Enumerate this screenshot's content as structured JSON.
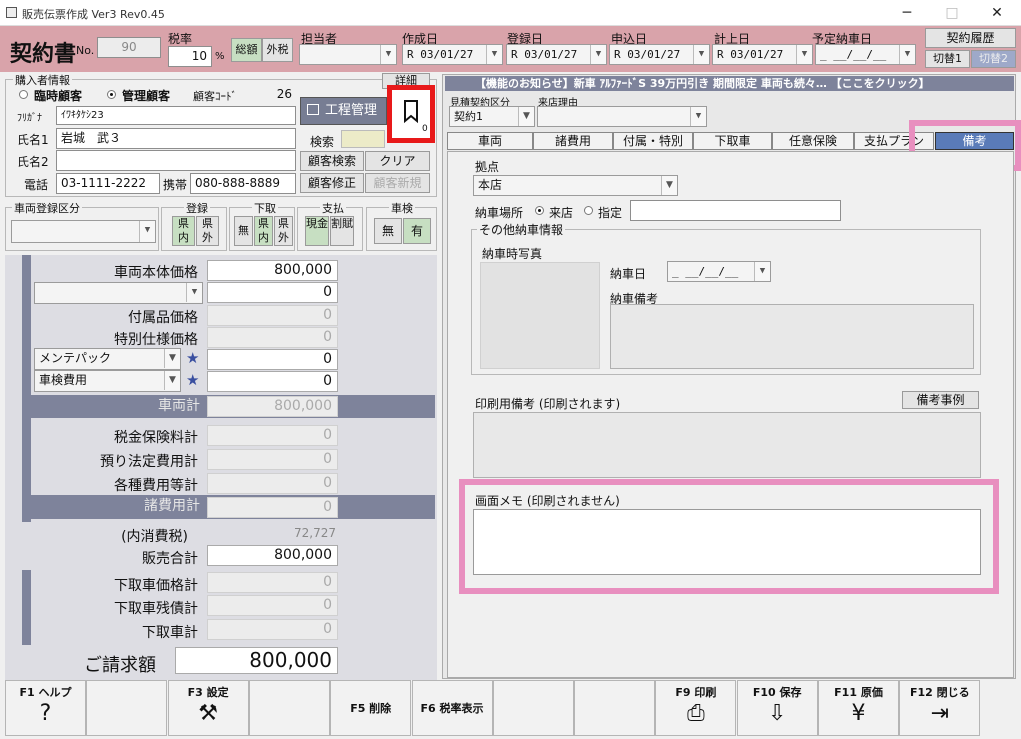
{
  "app": {
    "title": "販売伝票作成 Ver3 Rev0.45",
    "window_controls": [
      "─",
      "□",
      "✕"
    ]
  },
  "header": {
    "doc_title": "契約書",
    "no_label": "No.",
    "no_value": "90",
    "tax_label": "税率",
    "tax_value": "10",
    "tax_unit": "%",
    "tax_btn_total": "総額",
    "tax_btn_ex": "外税",
    "tanto_label": "担当者",
    "tanto_value": "",
    "created_label": "作成日",
    "created_value": "R 03/01/27",
    "reg_label": "登録日",
    "reg_value": "R 03/01/27",
    "apply_label": "申込日",
    "apply_value": "R 03/01/27",
    "post_label": "計上日",
    "post_value": "R 03/01/27",
    "due_label": "予定納車日",
    "due_value": "_ __/__/__",
    "history_btn": "契約履歴",
    "switch1": "切替1",
    "switch2": "切替2"
  },
  "buyer": {
    "group_label": "購入者情報",
    "detail_btn": "詳細",
    "radio_temp": "臨時顧客",
    "radio_mgmt": "管理顧客",
    "cust_code_label": "顧客ｺｰﾄﾞ",
    "cust_code": "26",
    "furigana_label": "ﾌﾘｶﾞﾅ",
    "furigana": "ｲﾜｷﾀｹｼ23",
    "name1_label": "氏名1",
    "name1": "岩城　武３",
    "name2_label": "氏名2",
    "name2": "",
    "phone_label": "電話",
    "phone": "03-1111-2222",
    "mobile_label": "携帯",
    "mobile": "080-888-8889",
    "koutei_btn": "工程管理",
    "search_label": "検索",
    "search_btn": "顧客検索",
    "clear_btn": "クリア",
    "modify_btn": "顧客修正",
    "new_btn": "顧客新規",
    "bookmark_count": "0"
  },
  "vehicle_reg": {
    "label": "車両登録区分",
    "reg_label": "登録",
    "reg_in": "県内",
    "reg_out": "県外",
    "trade_label": "下取",
    "trade_none": "無",
    "trade_in": "県内",
    "trade_out": "県外",
    "pay_label": "支払",
    "pay_cash": "現金",
    "pay_loan": "割賦",
    "inspect_label": "車検",
    "inspect_no": "無",
    "inspect_yes": "有"
  },
  "prices": {
    "body_price_label": "車両本体価格",
    "body_price": "800,000",
    "blank_value": "0",
    "acc_label": "付属品価格",
    "acc_value": "0",
    "spec_label": "特別仕様価格",
    "spec_value": "0",
    "maint_label": "メンテパック",
    "maint_value": "0",
    "inspect_label": "車検費用",
    "inspect_value": "0",
    "vehicle_total_label": "車両計",
    "vehicle_total": "800,000",
    "tax_ins_label": "税金保険料計",
    "tax_ins": "0",
    "deposit_label": "預り法定費用計",
    "deposit": "0",
    "misc_label": "各種費用等計",
    "misc": "0",
    "fees_total_label": "諸費用計",
    "fees_total": "0",
    "consumption_label": "(内消費税)",
    "consumption": "72,727",
    "sales_total_label": "販売合計",
    "sales_total": "800,000",
    "trade_price_label": "下取車価格計",
    "trade_price": "0",
    "trade_debt_label": "下取車残債計",
    "trade_debt": "0",
    "trade_total_label": "下取車計",
    "trade_total": "0",
    "invoice_label": "ご請求額",
    "invoice": "800,000"
  },
  "notice": "【機能のお知らせ】新車 ｱﾙﾌｧｰﾄﾞS 39万円引き 期間限定 車両も続々… 【ここをクリック】",
  "estimate": {
    "label": "見積契約区分",
    "value": "契約1",
    "reason_label": "来店理由",
    "reason_value": ""
  },
  "tabs": [
    "車両",
    "諸費用",
    "付属・特別",
    "下取車",
    "任意保険",
    "支払プラン",
    "備考"
  ],
  "biko": {
    "base_label": "拠点",
    "base_value": "本店",
    "place_label": "納車場所",
    "place_store": "来店",
    "place_spec": "指定",
    "other_label": "その他納車情報",
    "photo_label": "納車時写真",
    "date_label": "納車日",
    "date_value": "_ __/__/__",
    "note_label": "納車備考",
    "print_label": "印刷用備考 (印刷されます)",
    "example_btn": "備考事例",
    "memo_label": "画面メモ (印刷されません)"
  },
  "fkeys": [
    {
      "label": "F1 ヘルプ",
      "icon": "?"
    },
    {
      "label": "",
      "icon": ""
    },
    {
      "label": "F3 設定",
      "icon": "⚒"
    },
    {
      "label": "",
      "icon": ""
    },
    {
      "label": "F5 削除",
      "icon": ""
    },
    {
      "label": "F6 税率表示",
      "icon": ""
    },
    {
      "label": "",
      "icon": ""
    },
    {
      "label": "",
      "icon": ""
    },
    {
      "label": "F9 印刷",
      "icon": "⎙"
    },
    {
      "label": "F10 保存",
      "icon": "⇩"
    },
    {
      "label": "F11 原価",
      "icon": "¥"
    },
    {
      "label": "F12 閉じる",
      "icon": "⇥"
    }
  ],
  "colors": {
    "header": "#d9a3aa",
    "accent_bar": "#7e839b",
    "highlight_red": "#e8191a",
    "highlight_pink": "#e88fbf",
    "active_tab": "#5a7bb8"
  }
}
